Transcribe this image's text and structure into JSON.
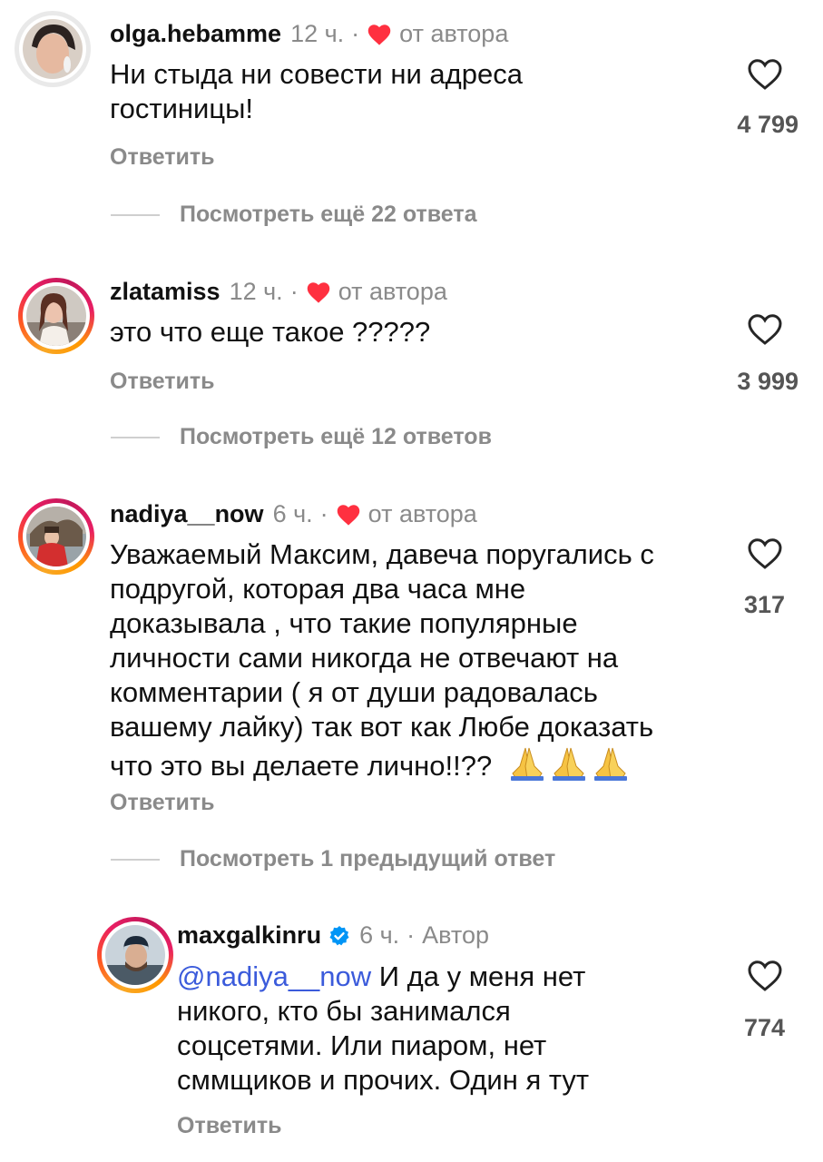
{
  "comments": [
    {
      "username": "olga.hebamme",
      "time": "12 ч.",
      "separator": "·",
      "author_like_label": "от автора",
      "text": "Ни стыда ни совести ни адреса гостиницы!",
      "likes": "4 799",
      "reply_label": "Ответить",
      "view_more": "Посмотреть ещё 22 ответа"
    },
    {
      "username": "zlatamiss",
      "time": "12 ч.",
      "separator": "·",
      "author_like_label": "от автора",
      "text": "это что еще такое ?????",
      "likes": "3 999",
      "reply_label": "Ответить",
      "view_more": "Посмотреть ещё 12 ответов"
    },
    {
      "username": "nadiya__now",
      "time": "6 ч.",
      "separator": "·",
      "author_like_label": "от автора",
      "text_lines": [
        "Уважаемый Максим, давеча поругались с",
        "подругой, которая два часа мне",
        "доказывала , что такие популярные",
        "личности  сами никогда не отвечают на",
        "комментарии ( я от души радовалась",
        "вашему лайку) так вот как Любе доказать",
        "что это вы делаете лично!!??"
      ],
      "likes": "317",
      "reply_label": "Ответить",
      "view_more": "Посмотреть 1 предыдущий ответ"
    }
  ],
  "reply": {
    "username": "maxgalkinru",
    "time": "6 ч.",
    "separator": "·",
    "author_label": "Автор",
    "mention": "@nadiya__now",
    "text_lines": [
      " И да у меня нет",
      "никого, кто бы занимался",
      "соцсетями. Или пиаром, нет",
      "сммщиков и прочих. Один я тут"
    ],
    "likes": "774",
    "reply_label": "Ответить"
  },
  "colors": {
    "heart_red": "#ff3040",
    "verified_blue": "#0095f6",
    "mention_blue": "#3b5bdb"
  }
}
